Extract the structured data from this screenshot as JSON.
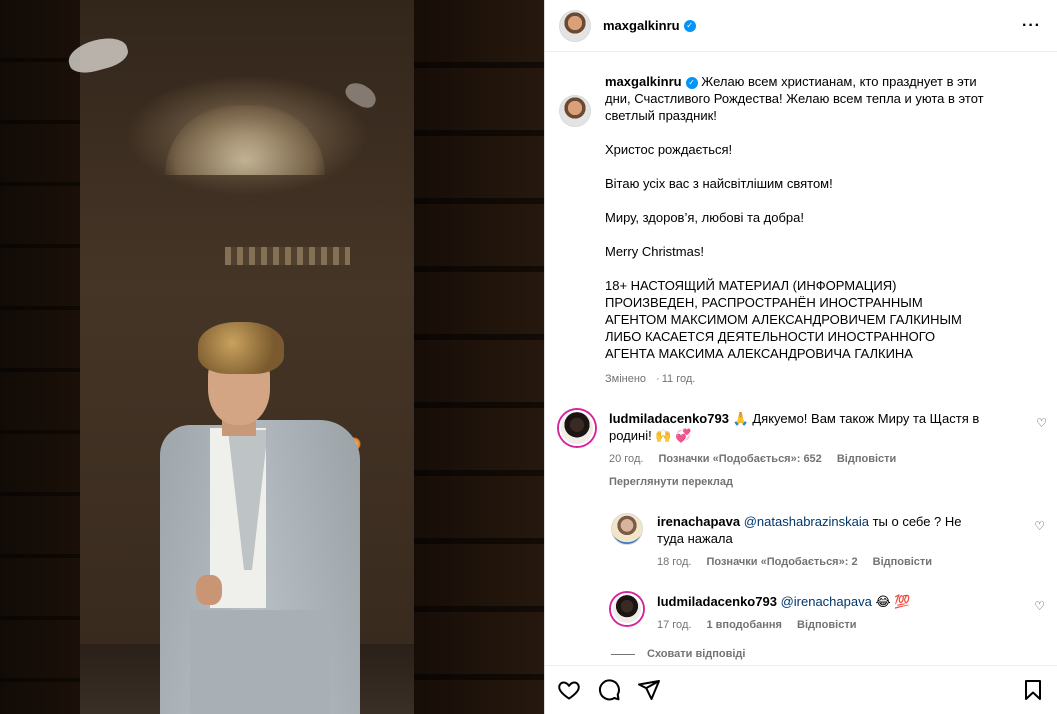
{
  "post": {
    "author": "maxgalkinru",
    "more_icon": "more-horizontal-icon"
  },
  "caption": {
    "author": "maxgalkinru",
    "first": "Желаю всем христианам, кто празднует в эти дни, Счастливого Рождества! Желаю всем тепла и уюта в этот светлый праздник!",
    "p2": "Христос рождається!",
    "p3": "Вітаю усіх вас з найсвітлішим святом!",
    "p4": "Миру, здоров’я, любові та добра!",
    "p5": "Merry Christmas!",
    "p6": "18+ НАСТОЯЩИЙ МАТЕРИАЛ (ИНФОРМАЦИЯ) ПРОИЗВЕДЕН, РАСПРОСТРАНЁН ИНОСТРАННЫМ АГЕНТОМ МАКСИМОМ АЛЕКСАНДРОВИЧЕМ ГАЛКИНЫМ ЛИБО КАСАЕТСЯ ДЕЯТЕЛЬНОСТИ ИНОСТРАННОГО АГЕНТА МАКСИМА АЛЕКСАНДРОВИЧА ГАЛКИНА",
    "edited": "Змінено",
    "time": "11 год."
  },
  "comments": [
    {
      "user": "ludmiladacenko793",
      "text": "🙏 Дякуемо! Вам також Миру та Щастя в родині! 🙌 💞",
      "time": "20 год.",
      "likes": "Позначки «Подобається»: 652",
      "reply": "Відповісти",
      "translate": "Переглянути переклад"
    }
  ],
  "replies": [
    {
      "user": "irenachapava",
      "mention": "@natashabrazinskaia",
      "text": "ты о себе ? Не туда нажала",
      "time": "18 год.",
      "likes": "Позначки «Подобається»: 2",
      "reply": "Відповісти"
    },
    {
      "user": "ludmiladacenko793",
      "mention": "@irenachapava",
      "text": "😂 💯",
      "time": "17 год.",
      "likes": "1 вподобання",
      "reply": "Відповісти"
    }
  ],
  "hide_replies": "Сховати відповіді",
  "actions": {
    "icons": [
      "heart-icon",
      "comment-icon",
      "share-icon",
      "bookmark-icon"
    ]
  },
  "colors": {
    "verified": "#0095f6",
    "mention": "#00376b",
    "meta": "#737373",
    "story_ring": "#d6249f"
  }
}
